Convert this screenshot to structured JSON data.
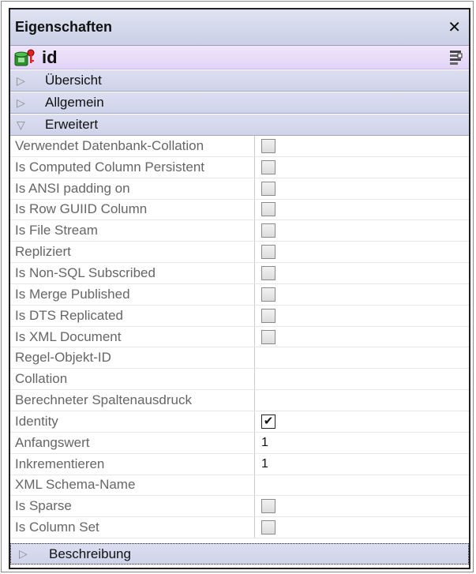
{
  "panel": {
    "title": "Eigenschaften",
    "close_glyph": "✕"
  },
  "object": {
    "name": "id",
    "icon": "db-column-key-icon",
    "sort_icon": "sort-properties-icon"
  },
  "sections": [
    {
      "label": "Übersicht",
      "expanded": false,
      "glyph": "▷"
    },
    {
      "label": "Allgemein",
      "expanded": false,
      "glyph": "▷"
    },
    {
      "label": "Erweitert",
      "expanded": true,
      "glyph": "▽"
    }
  ],
  "properties": [
    {
      "name": "Verwendet Datenbank-Collation",
      "type": "checkbox",
      "checked": false
    },
    {
      "name": "Is Computed Column Persistent",
      "type": "checkbox",
      "checked": false
    },
    {
      "name": "Is ANSI padding on",
      "type": "checkbox",
      "checked": false
    },
    {
      "name": "Is Row GUIID Column",
      "type": "checkbox",
      "checked": false
    },
    {
      "name": "Is File Stream",
      "type": "checkbox",
      "checked": false
    },
    {
      "name": "Repliziert",
      "type": "checkbox",
      "checked": false
    },
    {
      "name": "Is Non-SQL Subscribed",
      "type": "checkbox",
      "checked": false
    },
    {
      "name": "Is Merge Published",
      "type": "checkbox",
      "checked": false
    },
    {
      "name": "Is DTS Replicated",
      "type": "checkbox",
      "checked": false
    },
    {
      "name": "Is XML Document",
      "type": "checkbox",
      "checked": false
    },
    {
      "name": "Regel-Objekt-ID",
      "type": "text",
      "value": ""
    },
    {
      "name": "Collation",
      "type": "text",
      "value": ""
    },
    {
      "name": "Berechneter Spaltenausdruck",
      "type": "text",
      "value": ""
    },
    {
      "name": "Identity",
      "type": "checkbox",
      "checked": true
    },
    {
      "name": "Anfangswert",
      "type": "text",
      "value": "1"
    },
    {
      "name": "Inkrementieren",
      "type": "text",
      "value": "1"
    },
    {
      "name": "XML Schema-Name",
      "type": "text",
      "value": ""
    },
    {
      "name": "Is Sparse",
      "type": "checkbox",
      "checked": false
    },
    {
      "name": "Is Column Set",
      "type": "checkbox",
      "checked": false
    }
  ],
  "footer": {
    "label": "Beschreibung",
    "glyph": "▷"
  },
  "colors": {
    "title_bg": "#c9cfe6",
    "object_bg": "#e3d4f7",
    "section_bg": "#cfd3ea",
    "property_label": "#666666"
  }
}
